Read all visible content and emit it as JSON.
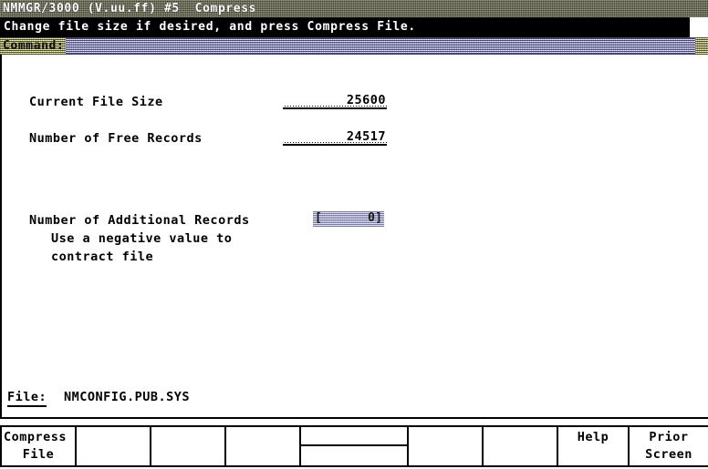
{
  "window": {
    "title": "NMMGR/3000 (V.uu.ff) #5  Compress",
    "instruction": "Change file size if desired, and press Compress File."
  },
  "command": {
    "label": "Command:",
    "value": "",
    "placeholder": ""
  },
  "form": {
    "current_file_size": {
      "label": "Current File Size",
      "value": "25600"
    },
    "number_of_free_records": {
      "label": "Number of Free Records",
      "value": "24517"
    },
    "number_of_additional_records": {
      "label": "Number of Additional Records",
      "hint_line1": "Use a negative value to",
      "hint_line2": "contract file",
      "bracket_left": "[",
      "bracket_right": "]",
      "value": "0"
    }
  },
  "file": {
    "label": "File:",
    "name": "NMCONFIG.PUB.SYS"
  },
  "function_keys": [
    {
      "line1": "Compress",
      "line2": "File",
      "divider": false
    },
    {
      "line1": "",
      "line2": "",
      "divider": false
    },
    {
      "line1": "",
      "line2": "",
      "divider": false
    },
    {
      "line1": "",
      "line2": "",
      "divider": false
    },
    {
      "line1": "",
      "line2": "",
      "divider": true
    },
    {
      "line1": "",
      "line2": "",
      "divider": false
    },
    {
      "line1": "",
      "line2": "",
      "divider": false
    },
    {
      "line1": "Help",
      "line2": "",
      "divider": false
    },
    {
      "line1": "Prior",
      "line2": "Screen",
      "divider": false
    }
  ],
  "colors": {
    "background": "#ffffff",
    "foreground": "#000000",
    "banner_background": "#000000",
    "banner_foreground": "#ffffff",
    "highlight_field": "#b9b9a8"
  }
}
